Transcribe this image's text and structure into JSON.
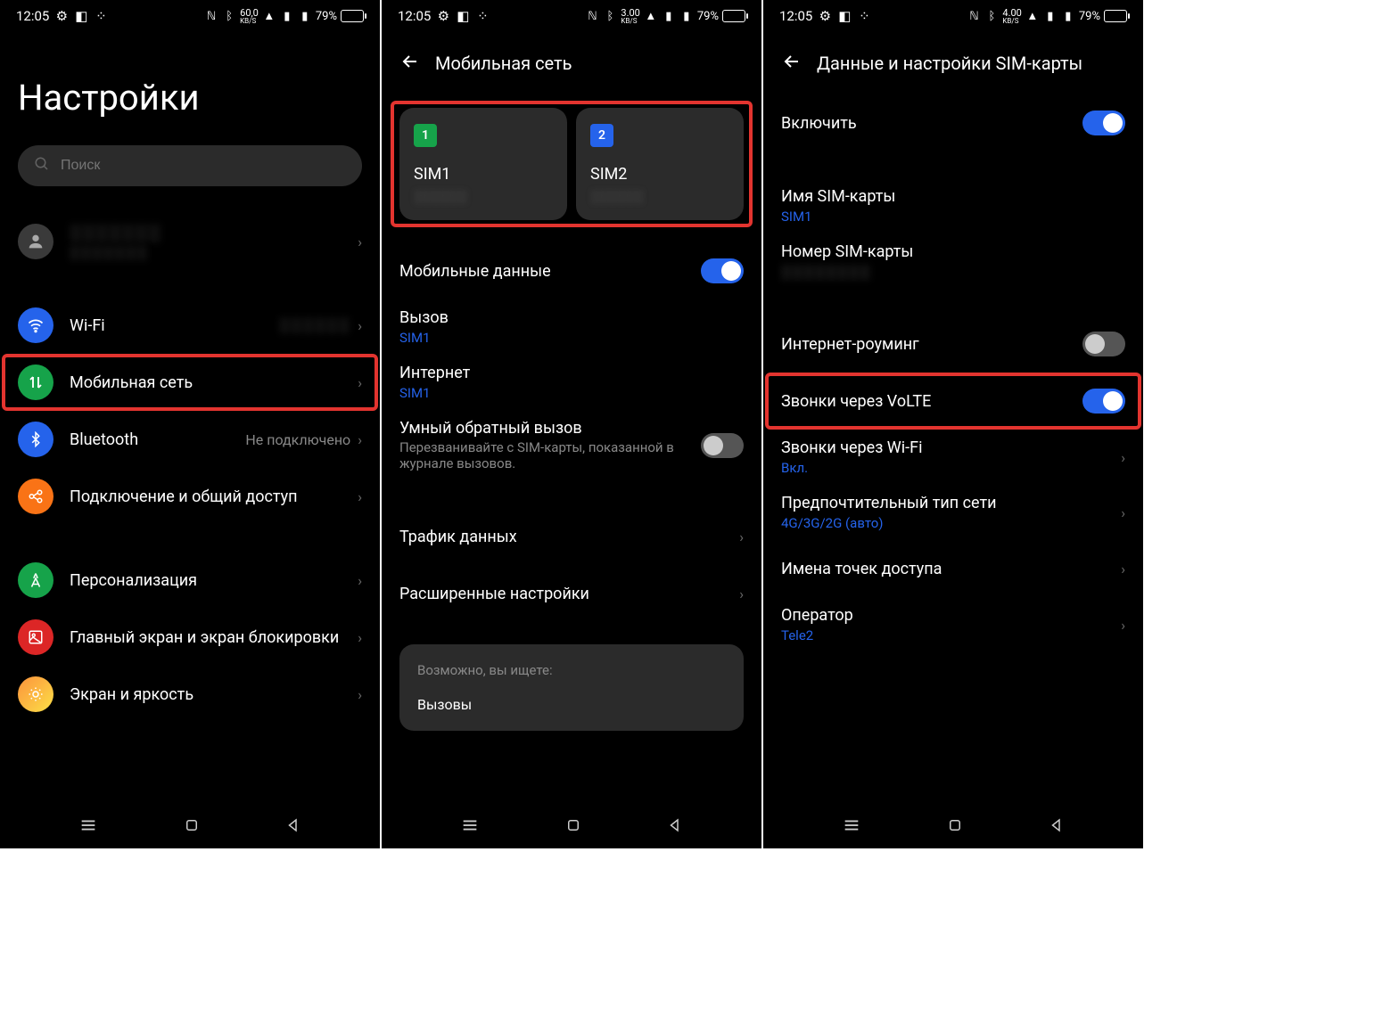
{
  "status": {
    "time": "12:05",
    "battery": "79%",
    "speed1": "60,0",
    "speed2": "3.00",
    "speed3": "4.00",
    "unit": "KB/S"
  },
  "s1": {
    "title": "Настройки",
    "search_placeholder": "Поиск",
    "profile": "░░░░░░░",
    "wifi": "Wi-Fi",
    "wifi_value": "░░░░░░",
    "mobile": "Мобильная сеть",
    "bluetooth": "Bluetooth",
    "bluetooth_value": "Не подключено",
    "sharing": "Подключение и общий доступ",
    "personalization": "Персонализация",
    "home": "Главный экран и экран блокировки",
    "display": "Экран и яркость"
  },
  "s2": {
    "title": "Мобильная сеть",
    "sim1": "SIM1",
    "sim2": "SIM2",
    "mobile_data": "Мобильные данные",
    "call": "Вызов",
    "call_sub": "SIM1",
    "internet": "Интернет",
    "internet_sub": "SIM1",
    "callback": "Умный обратный вызов",
    "callback_sub": "Перезванивайте с SIM-карты, показанной в журнале вызовов.",
    "traffic": "Трафик данных",
    "advanced": "Расширенные настройки",
    "hint_title": "Возможно, вы ищете:",
    "hint_item": "Вызовы"
  },
  "s3": {
    "title": "Данные и настройки SIM-карты",
    "enable": "Включить",
    "sim_name": "Имя SIM-карты",
    "sim_name_val": "SIM1",
    "sim_number": "Номер SIM-карты",
    "roaming": "Интернет-роуминг",
    "volte": "Звонки через VoLTE",
    "wifi_call": "Звонки через Wi-Fi",
    "wifi_call_val": "Вкл.",
    "net_type": "Предпочтительный тип сети",
    "net_type_val": "4G/3G/2G (авто)",
    "apn": "Имена точек доступа",
    "operator": "Оператор",
    "operator_val": "Tele2"
  }
}
